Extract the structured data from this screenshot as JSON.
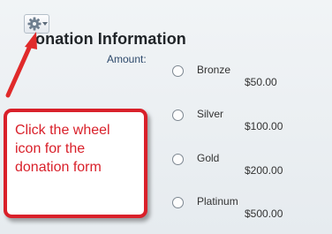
{
  "gear_button": {
    "icon": "gear-icon",
    "dropdown_icon": "caret-down-icon"
  },
  "form": {
    "title": "onation Information",
    "amount_label": "Amount:",
    "options": [
      {
        "name": "Bronze",
        "price": "$50.00",
        "selected": false
      },
      {
        "name": "Silver",
        "price": "$100.00",
        "selected": false
      },
      {
        "name": "Gold",
        "price": "$200.00",
        "selected": false
      },
      {
        "name": "Platinum",
        "price": "$500.00",
        "selected": false
      }
    ]
  },
  "callout": {
    "text": "Click the wheel icon for the donation form"
  },
  "colors": {
    "accent": "#d9202a",
    "label": "#2d4a6b"
  }
}
